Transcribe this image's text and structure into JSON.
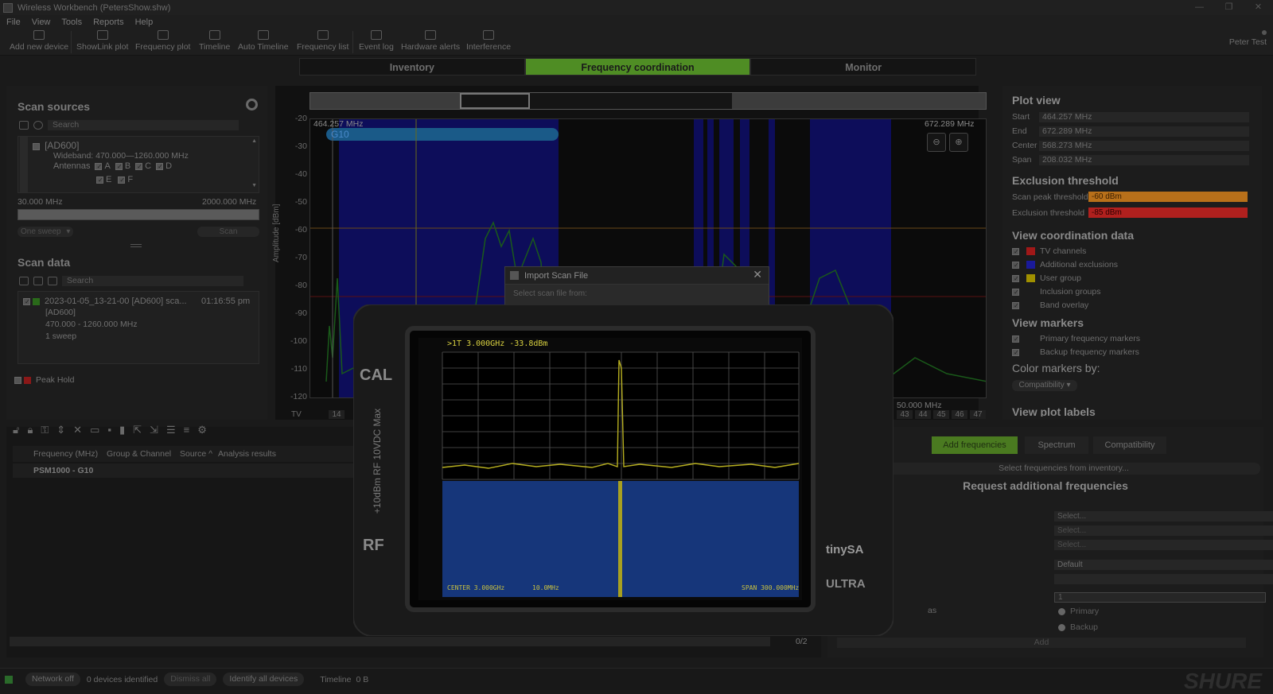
{
  "window": {
    "title": "Wireless Workbench (PetersShow.shw)"
  },
  "menu": [
    "File",
    "View",
    "Tools",
    "Reports",
    "Help"
  ],
  "toolbar": {
    "items": [
      "Add new device",
      "ShowLink plot",
      "Frequency plot",
      "Timeline",
      "Auto Timeline",
      "Frequency list",
      "Event log",
      "Hardware alerts",
      "Interference"
    ],
    "user": "Peter Test"
  },
  "tabs": [
    "Inventory",
    "Frequency coordination",
    "Monitor"
  ],
  "scan_sources": {
    "title": "Scan sources",
    "search_placeholder": "Search",
    "device_name": "[AD600]",
    "wideband": "Wideband: 470.000—1260.000 MHz",
    "antennas_label": "Antennas",
    "antennas": [
      "A",
      "B",
      "C",
      "D",
      "E",
      "F"
    ],
    "range_min": "30.000 MHz",
    "range_max": "2000.000 MHz",
    "sweep_select": "One sweep",
    "scan_button": "Scan"
  },
  "scan_data": {
    "title": "Scan data",
    "search_placeholder": "Search",
    "item_name": "2023-01-05_13-21-00 [AD600] sca...",
    "item_time": "01:16:55 pm",
    "item_device": "[AD600]",
    "item_range": "470.000 - 1260.000 MHz",
    "item_sweeps": "1 sweep",
    "peak_hold": "Peak Hold"
  },
  "plot": {
    "start_label": "464.257 MHz",
    "end_label": "672.289 MHz",
    "group_label": "G10",
    "ylabel": "Amplitude [dBm]",
    "yticks": [
      "-20",
      "-30",
      "-40",
      "-50",
      "-60",
      "-70",
      "-80",
      "-90",
      "-100",
      "-110",
      "-120"
    ],
    "tv_label": "TV",
    "tv_channels": [
      "14",
      "43",
      "44",
      "45",
      "46",
      "47"
    ],
    "freq_partial": "50.000 MHz"
  },
  "dialog": {
    "title": "Import Scan File",
    "body": "Select scan file from:"
  },
  "device_screen": {
    "header": ">1T  3.000GHz -33.8dBm",
    "cal": "CAL",
    "rf": "RF",
    "rating": "+10dBm RF  10VDC Max",
    "brand": "tinySA",
    "model": "ULTRA",
    "center": "CENTER 3.000GHz",
    "rbw": "10.0MHz",
    "span": "SPAN 300.000MHz"
  },
  "plot_view": {
    "title": "Plot view",
    "rows": [
      {
        "label": "Start",
        "value": "464.257 MHz"
      },
      {
        "label": "End",
        "value": "672.289 MHz"
      },
      {
        "label": "Center",
        "value": "568.273 MHz"
      },
      {
        "label": "Span",
        "value": "208.032 MHz"
      }
    ]
  },
  "exclusion": {
    "title": "Exclusion threshold",
    "scan_peak_label": "Scan peak threshold",
    "scan_peak_value": "-60 dBm",
    "scan_peak_color": "#b8701a",
    "excl_label": "Exclusion threshold",
    "excl_value": "-85 dBm",
    "excl_color": "#b0201e"
  },
  "coord_data": {
    "title": "View coordination data",
    "items": [
      {
        "label": "TV channels",
        "color": "#a01818"
      },
      {
        "label": "Additional exclusions",
        "color": "#1a1a9a"
      },
      {
        "label": "User group",
        "color": "#a09000"
      },
      {
        "label": "Inclusion groups",
        "color": ""
      },
      {
        "label": "Band overlay",
        "color": ""
      }
    ]
  },
  "markers": {
    "title": "View markers",
    "items": [
      "Primary frequency markers",
      "Backup frequency markers"
    ],
    "color_by_title": "Color markers by:",
    "color_by_value": "Compatibility",
    "plot_labels_title": "View plot labels"
  },
  "bottom_left": {
    "columns": [
      "Frequency (MHz)",
      "Group & Channel",
      "Source ^",
      "Analysis results"
    ],
    "group_row": "PSM1000 - G10",
    "pager": "0/2"
  },
  "bottom_right": {
    "tabs": [
      "Add frequencies",
      "Spectrum",
      "Compatibility"
    ],
    "select_inventory": "Select frequencies from inventory...",
    "request_title": "Request additional frequencies",
    "selects": [
      "Select...",
      "Select...",
      "Select...",
      "Default",
      ""
    ],
    "qty": "1",
    "as_label": "as",
    "radio_primary": "Primary",
    "radio_backup": "Backup",
    "add_button": "Add"
  },
  "status": {
    "network": "Network off",
    "devices": "0 devices identified",
    "dismiss": "Dismiss all",
    "identify": "Identify all devices",
    "timeline": "Timeline",
    "timeline_size": "0 B",
    "brand": "SHURE"
  }
}
